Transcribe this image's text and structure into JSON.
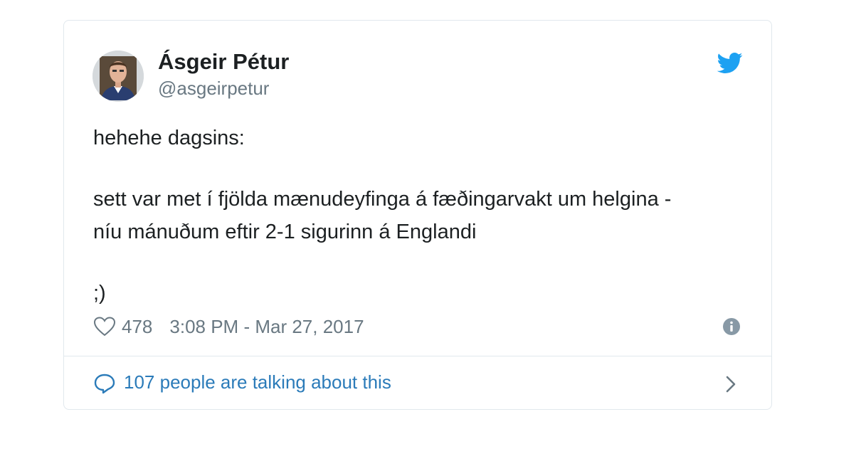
{
  "author": {
    "display_name": "Ásgeir Pétur",
    "handle": "@asgeirpetur"
  },
  "tweet": {
    "line1": "hehehe dagsins:",
    "line2": "sett var met í fjölda mænudeyfinga á fæðingarvakt um helgina -",
    "line3": "níu mánuðum eftir 2-1 sigurinn á Englandi",
    "line4": ";)"
  },
  "meta": {
    "likes": "478",
    "timestamp": "3:08 PM - Mar 27, 2017"
  },
  "conversation": {
    "label": "107 people are talking about this"
  },
  "icons": {
    "brand": "twitter-bird-icon",
    "like": "heart-icon",
    "info": "info-icon",
    "reply": "speech-bubble-icon",
    "more": "chevron-right-icon"
  },
  "colors": {
    "twitter_blue": "#1da1f2",
    "link_blue": "#2b7bb9",
    "text_dark": "#1c2022",
    "text_muted": "#697882",
    "border": "#e1e8ed"
  }
}
